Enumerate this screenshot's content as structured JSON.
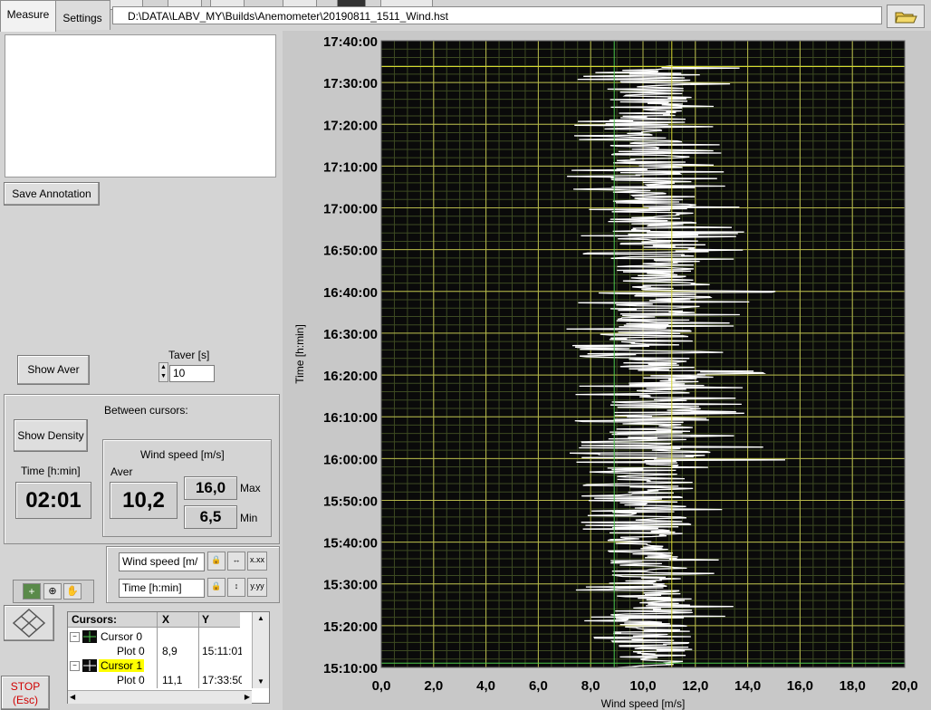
{
  "tabs": [
    {
      "label": "Measure",
      "active": true
    },
    {
      "label": "Settings",
      "active": false
    }
  ],
  "file_path": "D:\\DATA\\LABV_MY\\Builds\\Anemometer\\20190811_1511_Wind.hst",
  "left": {
    "save_annotation": "Save Annotation",
    "show_aver": "Show Aver",
    "taver_label": "Taver [s]",
    "taver_value": "10",
    "between_cursors": "Between cursors:",
    "show_density": "Show Density",
    "time_label": "Time [h:min]",
    "time_value": "02:01",
    "wind_label": "Wind speed [m/s]",
    "aver_label": "Aver",
    "aver_value": "10,2",
    "max_value": "16,0",
    "max_label": "Max",
    "min_value": "6,5",
    "min_label": "Min",
    "axis_x_name": "Wind speed [m/",
    "axis_y_name": "Time [h:min]",
    "stop_label": "STOP",
    "stop_sub": "(Esc)"
  },
  "cursors": {
    "headers": [
      "Cursors:",
      "X",
      "Y"
    ],
    "rows": [
      {
        "name": "Cursor 0",
        "plot": "Plot 0",
        "x": "8,9",
        "y": "15:11:01",
        "highlight": false
      },
      {
        "name": "Cursor 1",
        "plot": "Plot 0",
        "x": "11,1",
        "y": "17:33:50",
        "highlight": true
      }
    ]
  },
  "colors": {
    "plot_bg": "#0a0a0a",
    "grid_major": "#b7b84a",
    "grid_minor": "#3d4a22",
    "trace": "#ffffff",
    "cursor0": "#4cc94c",
    "cursor1": "#d8d830",
    "cursor1_highlight": "#ffff00",
    "stop_text": "#d00000"
  },
  "chart_data": {
    "type": "line",
    "xlabel": "Wind speed [m/s]",
    "ylabel": "Time [h:min]",
    "xlim": [
      0,
      20
    ],
    "ylim": [
      "15:10:00",
      "17:40:00"
    ],
    "x_ticks": [
      "0,0",
      "2,0",
      "4,0",
      "6,0",
      "8,0",
      "10,0",
      "12,0",
      "14,0",
      "16,0",
      "18,0",
      "20,0"
    ],
    "y_ticks": [
      "15:10:00",
      "15:20:00",
      "15:30:00",
      "15:40:00",
      "15:50:00",
      "16:00:00",
      "16:10:00",
      "16:20:00",
      "16:30:00",
      "16:40:00",
      "16:50:00",
      "17:00:00",
      "17:10:00",
      "17:20:00",
      "17:30:00",
      "17:40:00"
    ],
    "grid": true,
    "cursors": [
      {
        "name": "Cursor 0",
        "x": 8.9,
        "y": "15:11:01"
      },
      {
        "name": "Cursor 1",
        "x": 11.1,
        "y": "17:33:50"
      }
    ],
    "series": [
      {
        "time": [
          "15:10",
          "15:15",
          "15:20",
          "15:25",
          "15:30",
          "15:35",
          "15:40",
          "15:45",
          "15:50",
          "15:55",
          "16:00",
          "16:05",
          "16:10",
          "16:15",
          "16:20",
          "16:25",
          "16:30",
          "16:35",
          "16:40",
          "16:45",
          "16:50",
          "16:55",
          "17:00",
          "17:05",
          "17:10",
          "17:15",
          "17:20",
          "17:25",
          "17:30",
          "17:34"
        ],
        "mean": [
          10.3,
          10.5,
          10.2,
          10.4,
          10.1,
          10.3,
          9.9,
          10.4,
          10.3,
          10.6,
          10.5,
          10.4,
          10.7,
          10.3,
          10.8,
          10.4,
          10.1,
          10.3,
          10.6,
          10.5,
          10.7,
          10.4,
          10.5,
          10.3,
          10.1,
          10.2,
          10.0,
          10.2,
          10.4,
          10.6
        ],
        "min": [
          8.0,
          7.6,
          7.6,
          7.5,
          7.3,
          7.5,
          7.2,
          7.3,
          7.6,
          7.5,
          7.2,
          7.1,
          7.3,
          7.1,
          7.5,
          7.3,
          7.0,
          7.2,
          6.9,
          7.1,
          7.4,
          7.2,
          7.4,
          7.1,
          7.0,
          7.3,
          7.0,
          7.3,
          7.4,
          7.8
        ],
        "max": [
          12.6,
          13.6,
          13.0,
          13.5,
          12.9,
          13.1,
          12.4,
          13.2,
          13.0,
          13.4,
          15.9,
          14.0,
          14.3,
          13.6,
          14.8,
          13.5,
          13.5,
          13.8,
          15.3,
          13.6,
          14.3,
          13.9,
          13.8,
          13.5,
          13.2,
          13.1,
          12.8,
          13.0,
          13.9,
          13.7
        ]
      }
    ]
  }
}
